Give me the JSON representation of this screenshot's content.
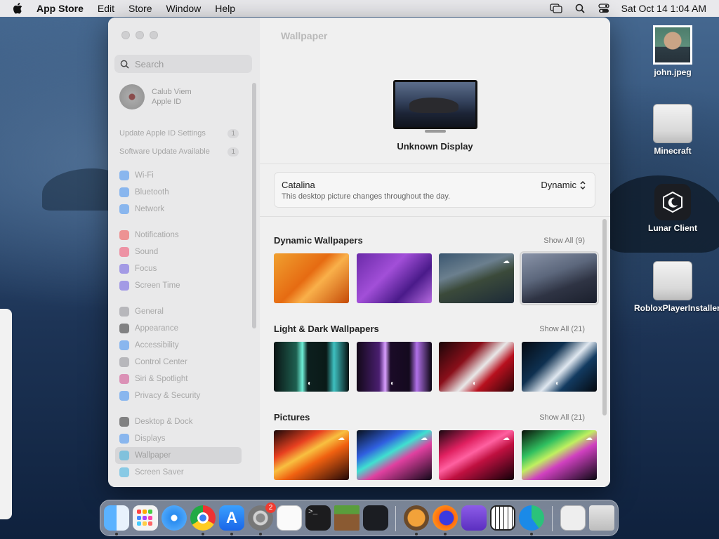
{
  "menubar": {
    "app_name": "App Store",
    "items": [
      "Edit",
      "Store",
      "Window",
      "Help"
    ],
    "datetime": "Sat Oct 14  1:04 AM"
  },
  "settings": {
    "search_placeholder": "Search",
    "user": {
      "name": "Calub Viem",
      "sub": "Apple ID"
    },
    "notices": [
      {
        "label": "Update Apple ID Settings",
        "count": "1"
      },
      {
        "label": "Software Update Available",
        "count": "1"
      }
    ],
    "nav": [
      {
        "label": "Wi-Fi",
        "color": "#3b8cf0"
      },
      {
        "label": "Bluetooth",
        "color": "#3b8cf0"
      },
      {
        "label": "Network",
        "color": "#3b8cf0"
      },
      {
        "label": "Notifications",
        "color": "#f04a4a"
      },
      {
        "label": "Sound",
        "color": "#f04a6a"
      },
      {
        "label": "Focus",
        "color": "#6a5ae0"
      },
      {
        "label": "Screen Time",
        "color": "#6a5ae0"
      },
      {
        "label": "General",
        "color": "#8e8e93"
      },
      {
        "label": "Appearance",
        "color": "#2b2b2b"
      },
      {
        "label": "Accessibility",
        "color": "#3b8cf0"
      },
      {
        "label": "Control Center",
        "color": "#8e8e93"
      },
      {
        "label": "Siri & Spotlight",
        "color": "#d0488a"
      },
      {
        "label": "Privacy & Security",
        "color": "#3b8cf0"
      },
      {
        "label": "Desktop & Dock",
        "color": "#2b2b2b"
      },
      {
        "label": "Displays",
        "color": "#3b8cf0"
      },
      {
        "label": "Wallpaper",
        "color": "#3bb0e0"
      },
      {
        "label": "Screen Saver",
        "color": "#3bb0e0"
      }
    ],
    "page_title": "Wallpaper",
    "display_name": "Unknown Display",
    "current": {
      "name": "Catalina",
      "description": "This desktop picture changes throughout the day.",
      "mode": "Dynamic"
    },
    "sections": [
      {
        "title": "Dynamic Wallpapers",
        "show_all": "Show All (9)"
      },
      {
        "title": "Light & Dark Wallpapers",
        "show_all": "Show All (21)"
      },
      {
        "title": "Pictures",
        "show_all": "Show All (21)"
      }
    ]
  },
  "desktop_icons": [
    {
      "label": "john.jpeg",
      "icon": "photo-icon"
    },
    {
      "label": "Minecraft",
      "icon": "drive-icon"
    },
    {
      "label": "Lunar Client",
      "icon": "lunar-client-icon"
    },
    {
      "label": "RobloxPlayerInstaller",
      "icon": "drive-icon"
    }
  ],
  "dock": {
    "apps": [
      "finder",
      "launchpad",
      "safari",
      "chrome",
      "app-store",
      "system-settings",
      "textedit",
      "terminal",
      "minecraft",
      "lunar-client",
      "downloads",
      "firefox",
      "simulator",
      "piano",
      "edge",
      "installer",
      "trash"
    ],
    "settings_badge": "2"
  }
}
